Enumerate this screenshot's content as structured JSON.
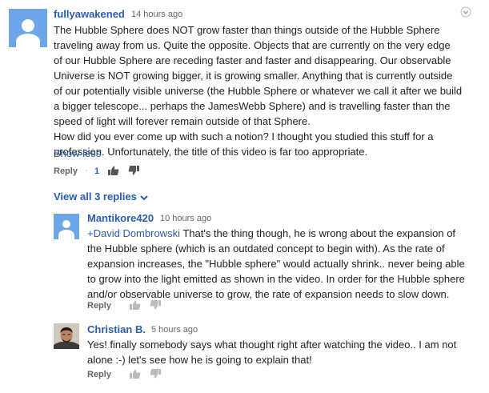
{
  "comment": {
    "author": "fullyawakened",
    "time": "14 hours ago",
    "body_lines": [
      "The Hubble Sphere does NOT grow faster than things outside of the Hubble Sphere",
      "traveling away from us.  Quite the opposite.  Objects that are currently on the very edge",
      "of our Hubble Sphere are receding faster and faster and disappearing.  Our observable",
      "Universe is NOT growing bigger, it is growing smaller.  Anything that is currently outside",
      "of our potentially visible universe (the Hubble Sphere or whatever we call it after we build",
      "a bigger telescope... perhaps the JamesWebb Sphere) and is travelling faster than the",
      "speed of light will forever remain outside of that Sphere.",
      "How did you ever come up with such a notion?  I thought you studied this stuff for a",
      "profession.  Unfortunately, the title of this video is far too appropriate."
    ],
    "show_less": "Show less",
    "reply_label": "Reply",
    "separator": "·",
    "like_count": "1"
  },
  "view_all_replies": "View all 3 replies",
  "replies": [
    {
      "author": "Mantikore420",
      "time": "10 hours ago",
      "mention": "+David Dombrowski",
      "first_line_rest": " That's the thing though, he is wrong about the expansion of",
      "body_lines": [
        "the Hubble sphere (which is an outdated concept to begin with). As the rate of",
        "expansion increases, the \"Hubble sphere\" would actually shrink.. never being able",
        "to grow into the light emitted as shown in the video. In order for the Hubble sphere",
        "and/or observable universe to grow, the rate of expansion needs to slow down."
      ],
      "reply_label": "Reply"
    },
    {
      "author": "Christian B.",
      "time": "5 hours ago",
      "body_lines": [
        "Yes! finally somebody says what thought right after watching the video.. I am not",
        "alone :-) let's see how he is going to explain that!"
      ],
      "reply_label": "Reply"
    }
  ],
  "colors": {
    "link": "#2a5db0",
    "avatar_default": "#6ea5e9",
    "muted": "#666666"
  },
  "icons": [
    "default-avatar-icon",
    "thumbs-up-icon",
    "thumbs-down-icon",
    "chevron-down-icon",
    "comment-menu-icon"
  ]
}
